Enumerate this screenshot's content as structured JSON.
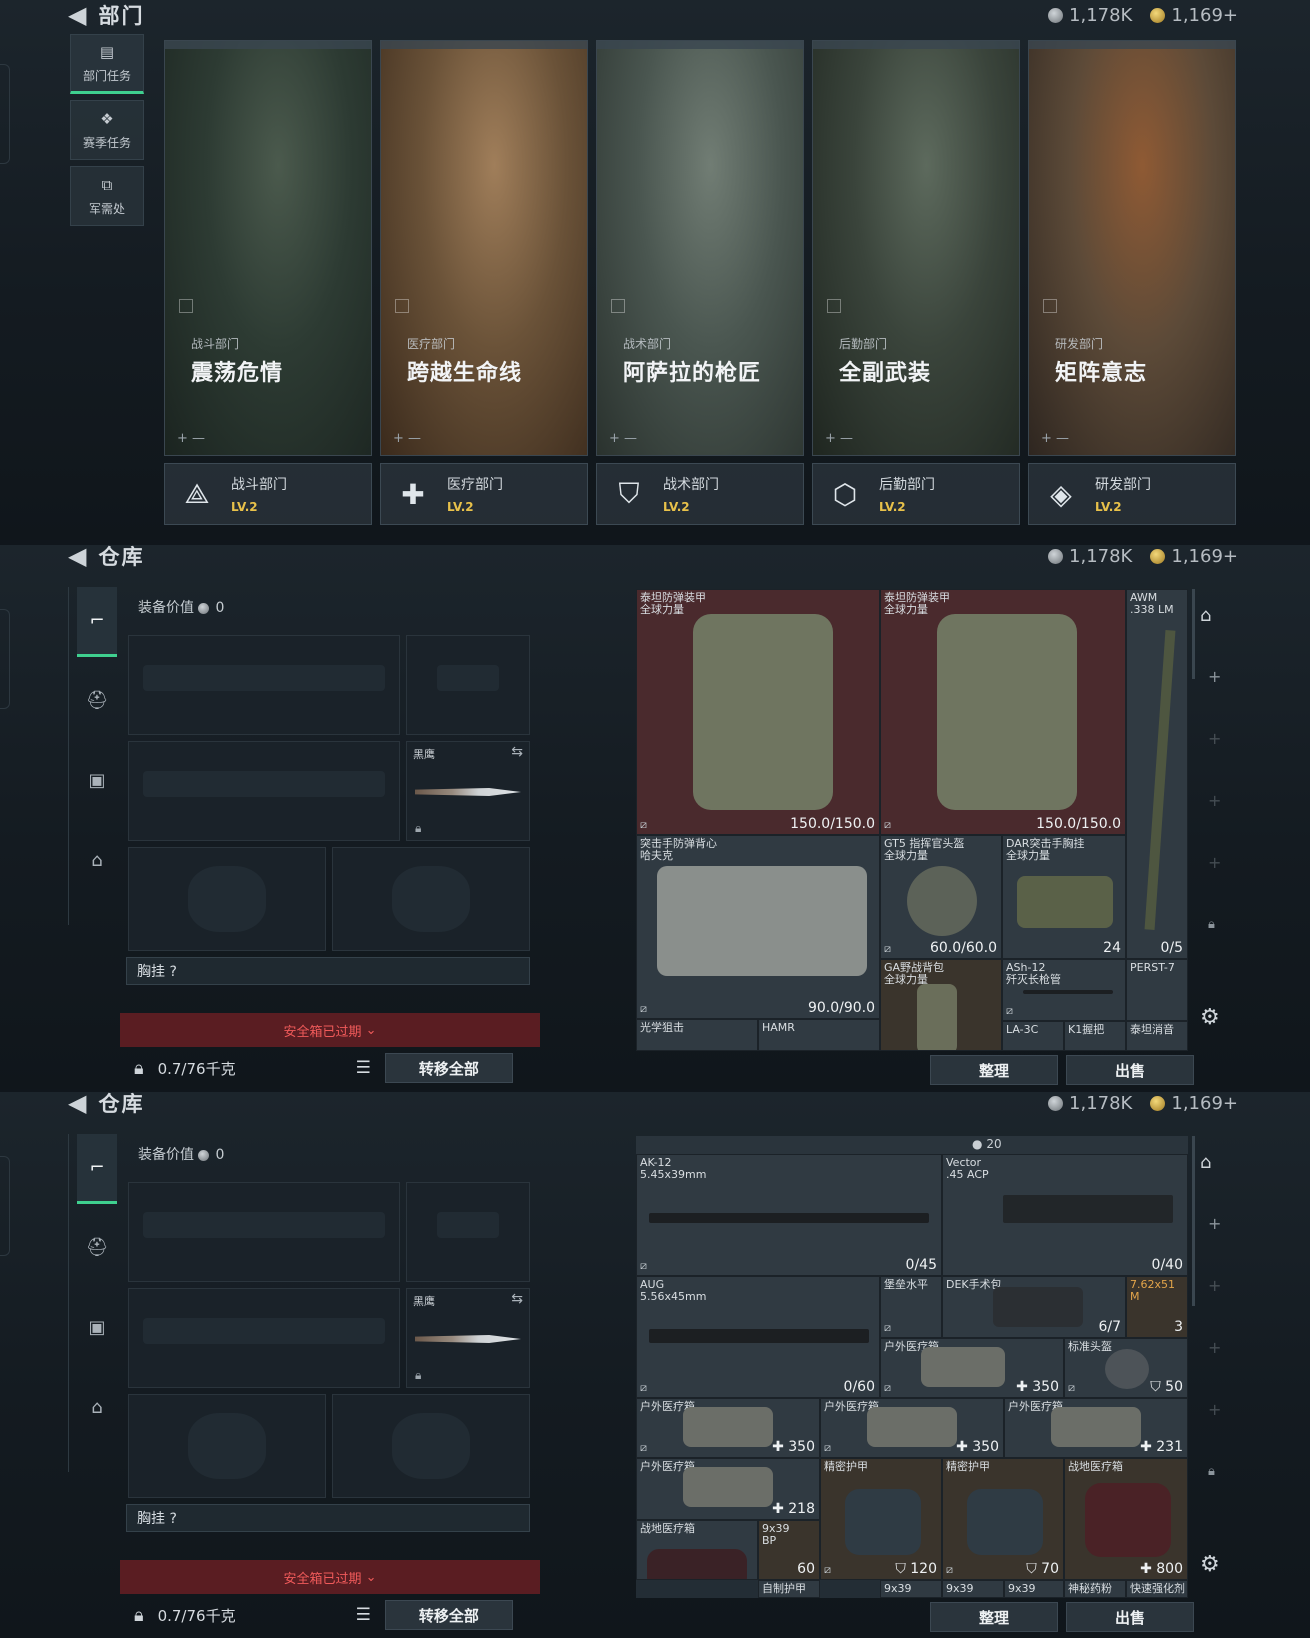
{
  "top": {
    "header": {
      "title": "部门",
      "silver": "1,178K",
      "gold": "1,169+"
    },
    "nav": [
      {
        "label": "部门任务",
        "icon": "task-icon"
      },
      {
        "label": "赛季任务",
        "icon": "season-icon"
      },
      {
        "label": "军需处",
        "icon": "supply-icon"
      }
    ],
    "cards": [
      {
        "dept": "战斗部门",
        "mission": "震荡危情",
        "colors": [
          "#2d3b33",
          "#4b5a4d",
          "#1b2420"
        ]
      },
      {
        "dept": "医疗部门",
        "mission": "跨越生命线",
        "colors": [
          "#6a5238",
          "#a07e5a",
          "#3a2a1c"
        ]
      },
      {
        "dept": "战术部门",
        "mission": "阿萨拉的枪匠",
        "colors": [
          "#4a5650",
          "#717d74",
          "#2a322e"
        ]
      },
      {
        "dept": "后勤部门",
        "mission": "全副武装",
        "colors": [
          "#3a443b",
          "#5d6a5d",
          "#1f2620"
        ]
      },
      {
        "dept": "研发部门",
        "mission": "矩阵意志",
        "colors": [
          "#5c4a38",
          "#8f5a34",
          "#2e2620"
        ]
      }
    ],
    "levels": [
      {
        "name": "战斗部门",
        "level": "LV.2",
        "icon": "combat-dept-icon",
        "glyph": "⟁"
      },
      {
        "name": "医疗部门",
        "level": "LV.2",
        "icon": "medical-dept-icon",
        "glyph": "✚"
      },
      {
        "name": "战术部门",
        "level": "LV.2",
        "icon": "tactical-dept-icon",
        "glyph": "⛉"
      },
      {
        "name": "后勤部门",
        "level": "LV.2",
        "icon": "logistics-dept-icon",
        "glyph": "⬡"
      },
      {
        "name": "研发部门",
        "level": "LV.2",
        "icon": "rnd-dept-icon",
        "glyph": "◈"
      }
    ]
  },
  "wh1": {
    "header": {
      "title": "仓库",
      "silver": "1,178K",
      "gold": "1,169+"
    },
    "equip_value_label": "装备价值",
    "equip_value": "0",
    "knife_label": "黑鹰",
    "chest_label": "胸挂 ?",
    "safe_label": "安全箱已过期",
    "weight": "0.7/76千克",
    "transfer_label": "转移全部",
    "sort_label": "整理",
    "sell_label": "出售",
    "items": [
      {
        "name": "泰坦防弹装甲\n全球力量",
        "value": "150.0/150.0"
      },
      {
        "name": "泰坦防弹装甲\n全球力量",
        "value": "150.0/150.0"
      },
      {
        "name": "AWM\n.338 LM",
        "value": "0/5"
      },
      {
        "name": "突击手防弹背心\n哈夫克",
        "value": "90.0/90.0"
      },
      {
        "name": "GT5 指挥官头盔\n全球力量",
        "value": "60.0/60.0"
      },
      {
        "name": "DAR突击手胸挂\n全球力量",
        "value": "24"
      },
      {
        "name": "GA野战背包\n全球力量",
        "value": ""
      },
      {
        "name": "ASh-12\n歼灭长枪管",
        "value": ""
      },
      {
        "name": "PERST-7",
        "value": ""
      },
      {
        "name": "光学狙击",
        "value": ""
      },
      {
        "name": "HAMR",
        "value": ""
      },
      {
        "name": "LA-3C",
        "value": ""
      },
      {
        "name": "K1握把",
        "value": ""
      },
      {
        "name": "泰坦消音",
        "value": ""
      }
    ]
  },
  "wh2": {
    "header": {
      "title": "仓库",
      "silver": "1,178K",
      "gold": "1,169+"
    },
    "equip_value_label": "装备价值",
    "equip_value": "0",
    "knife_label": "黑鹰",
    "chest_label": "胸挂 ?",
    "safe_label": "安全箱已过期",
    "weight": "0.7/76千克",
    "transfer_label": "转移全部",
    "sort_label": "整理",
    "sell_label": "出售",
    "top_count": "20",
    "items": [
      {
        "name": "AK-12\n5.45x39mm",
        "value": "0/45"
      },
      {
        "name": "Vector\n.45 ACP",
        "value": "0/40"
      },
      {
        "name": "AUG\n5.56x45mm",
        "value": "0/60"
      },
      {
        "name": "堡垒水平",
        "value": ""
      },
      {
        "name": "DEK手术包",
        "value": "6/7"
      },
      {
        "name": "7.62x51\nM",
        "value": "3"
      },
      {
        "name": "户外医疗箱",
        "value": "350"
      },
      {
        "name": "标准头盔",
        "value": "50"
      },
      {
        "name": "户外医疗箱",
        "value": "350"
      },
      {
        "name": "户外医疗箱",
        "value": "350"
      },
      {
        "name": "户外医疗箱",
        "value": "231"
      },
      {
        "name": "户外医疗箱",
        "value": "218"
      },
      {
        "name": "精密护甲",
        "value": "120"
      },
      {
        "name": "精密护甲",
        "value": "70"
      },
      {
        "name": "战地医疗箱",
        "value": "800"
      },
      {
        "name": "战地医疗箱",
        "value": ""
      },
      {
        "name": "9x39\nBP",
        "value": "60"
      },
      {
        "name": "自制护甲",
        "value": ""
      },
      {
        "name": "9x39",
        "value": ""
      },
      {
        "name": "9x39",
        "value": ""
      },
      {
        "name": "9x39",
        "value": ""
      },
      {
        "name": "神秘药粉",
        "value": ""
      },
      {
        "name": "快速强化剂",
        "value": ""
      }
    ]
  },
  "colors": {
    "accent": "#3fd08f",
    "level": "#e8c14a",
    "alert": "#f05a5a"
  }
}
